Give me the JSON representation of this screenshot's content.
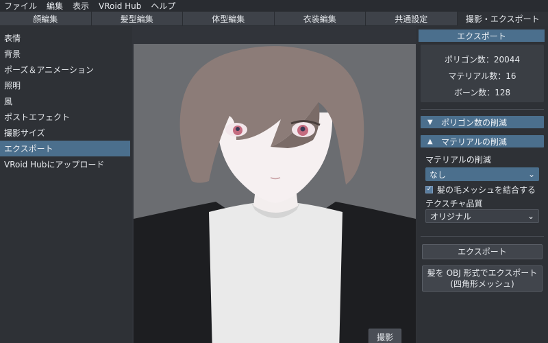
{
  "menu": [
    "ファイル",
    "編集",
    "表示",
    "VRoid Hub",
    "ヘルプ"
  ],
  "tabs": [
    {
      "label": "顔編集",
      "active": false
    },
    {
      "label": "髪型編集",
      "active": false
    },
    {
      "label": "体型編集",
      "active": false
    },
    {
      "label": "衣装編集",
      "active": false
    },
    {
      "label": "共通設定",
      "active": false
    },
    {
      "label": "撮影・エクスポート",
      "active": true
    }
  ],
  "sidebar": {
    "items": [
      {
        "label": "表情",
        "active": false
      },
      {
        "label": "背景",
        "active": false
      },
      {
        "label": "ポーズ＆アニメーション",
        "active": false
      },
      {
        "label": "照明",
        "active": false
      },
      {
        "label": "風",
        "active": false
      },
      {
        "label": "ポストエフェクト",
        "active": false
      },
      {
        "label": "撮影サイズ",
        "active": false
      },
      {
        "label": "エクスポート",
        "active": true
      },
      {
        "label": "VRoid Hubにアップロード",
        "active": false
      }
    ]
  },
  "viewport": {
    "shoot_label": "撮影"
  },
  "export_panel": {
    "title": "エクスポート",
    "stats": {
      "polygons": "ポリゴン数：20044",
      "materials": "マテリアル数：16",
      "bones": "ボーン数：128"
    },
    "polygon_reduction": {
      "label": "ポリゴン数の削減",
      "expanded": false
    },
    "material_reduction": {
      "label": "マテリアルの削減",
      "expanded": true,
      "field_label": "マテリアルの削減",
      "select_value": "なし",
      "merge_hair_label": "髪の毛メッシュを結合する",
      "merge_hair_checked": true,
      "texture_quality_label": "テクスチャ品質",
      "texture_quality_value": "オリジナル"
    },
    "export_button": "エクスポート",
    "obj_export_line1": "髪を OBJ 形式でエクスポート",
    "obj_export_line2": "(四角形メッシュ)"
  },
  "colors": {
    "accent": "#4b6f8d",
    "background": "#2e3136"
  }
}
